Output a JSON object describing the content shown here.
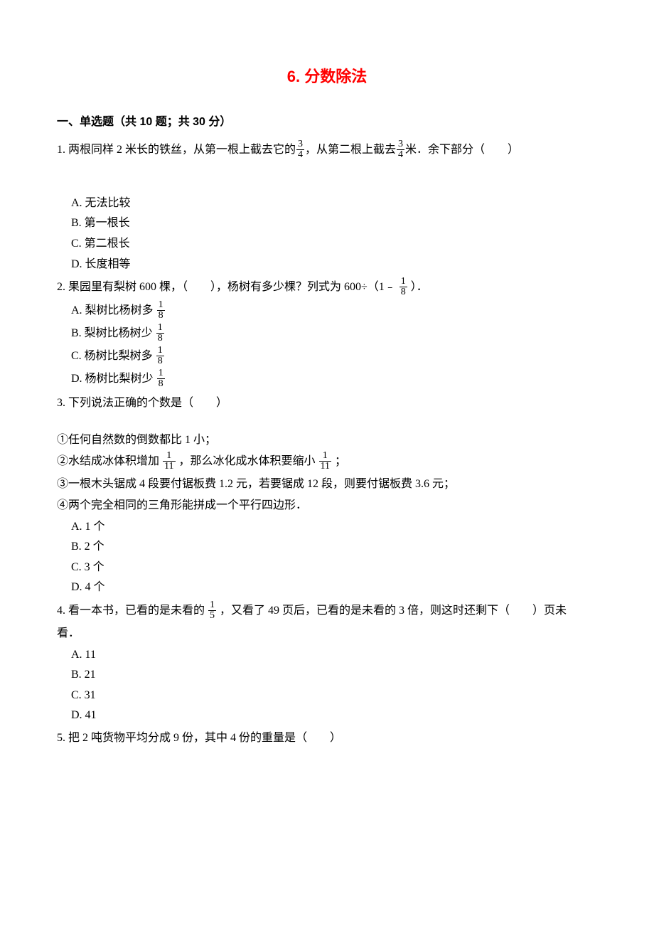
{
  "title": "6. 分数除法",
  "section_header": "一、单选题（共 10 题；共 30 分）",
  "q1": {
    "stem_a": "1. 两根同样 2 米长的铁丝，从第一根上截去它的",
    "frac1_num": "3",
    "frac1_den": "4",
    "stem_b": "，从第二根上截去",
    "frac2_num": "3",
    "frac2_den": "4",
    "stem_c": "米．余下部分（　　）",
    "A": "A. 无法比较",
    "B": "B. 第一根长",
    "C": "C. 第二根长",
    "D": "D. 长度相等"
  },
  "q2": {
    "stem_a": "2. 果园里有梨树 600 棵，（　　），杨树有多少棵？列式为 600÷（1﹣ ",
    "fr_num": "1",
    "fr_den": "8",
    "stem_b": " ）．",
    "A_pre": "A. 梨树比杨树多 ",
    "A_num": "1",
    "A_den": "8",
    "B_pre": "B. 梨树比杨树少 ",
    "B_num": "1",
    "B_den": "8",
    "C_pre": "C. 杨树比梨树多 ",
    "C_num": "1",
    "C_den": "8",
    "D_pre": "D. 杨树比梨树少 ",
    "D_num": "1",
    "D_den": "8"
  },
  "q3": {
    "stem": "3. 下列说法正确的个数是（　　）",
    "s1": "①任何自然数的倒数都比 1 小；",
    "s2a": "②水结成冰体积增加 ",
    "s2_num1": "1",
    "s2_den1": "11",
    "s2b": " ，那么冰化成水体积要缩小 ",
    "s2_num2": "1",
    "s2_den2": "11",
    "s2c": " ；",
    "s3": "③一根木头锯成 4 段要付锯板费 1.2 元，若要锯成 12 段，则要付锯板费 3.6 元；",
    "s4": "④两个完全相同的三角形能拼成一个平行四边形．",
    "A": "A. 1 个",
    "B": "B. 2 个",
    "C": "C. 3 个",
    "D": "D. 4 个"
  },
  "q4": {
    "stem_a": "4. 看一本书，已看的是未看的 ",
    "fr_num": "1",
    "fr_den": "5",
    "stem_b": " ，又看了 49 页后，已看的是未看的 3 倍，则这时还剩下（　　）页未",
    "stem_c": "看．",
    "A": "A. 11",
    "B": "B. 21",
    "C": "C. 31",
    "D": "D. 41"
  },
  "q5": {
    "stem": "5. 把 2 吨货物平均分成 9 份，其中 4 份的重量是（　　）"
  }
}
